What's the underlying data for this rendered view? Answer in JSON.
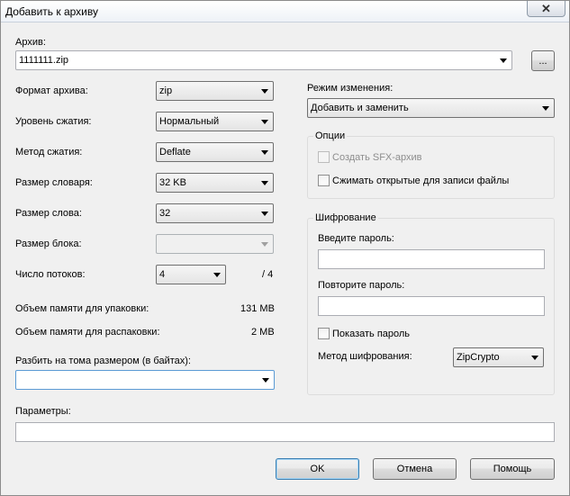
{
  "window": {
    "title": "Добавить к архиву"
  },
  "archive": {
    "label": "Архив:",
    "value": "1111111.zip",
    "browse_label": "..."
  },
  "left": {
    "format": {
      "label": "Формат архива:",
      "value": "zip"
    },
    "level": {
      "label": "Уровень сжатия:",
      "value": "Нормальный"
    },
    "method": {
      "label": "Метод сжатия:",
      "value": "Deflate"
    },
    "dict": {
      "label": "Размер словаря:",
      "value": "32 KB"
    },
    "word": {
      "label": "Размер слова:",
      "value": "32"
    },
    "block": {
      "label": "Размер блока:",
      "value": ""
    },
    "threads": {
      "label": "Число потоков:",
      "value": "4",
      "max": "/ 4"
    },
    "mem_pack": {
      "label": "Объем памяти для упаковки:",
      "value": "131 MB"
    },
    "mem_unpack": {
      "label": "Объем памяти для распаковки:",
      "value": "2 MB"
    },
    "split": {
      "label": "Разбить на тома размером (в байтах):",
      "value": ""
    }
  },
  "right": {
    "update_mode": {
      "label": "Режим изменения:",
      "value": "Добавить и заменить"
    },
    "options": {
      "title": "Опции",
      "sfx_label": "Создать SFX-архив",
      "shared_label": "Сжимать открытые для записи файлы"
    },
    "encryption": {
      "title": "Шифрование",
      "password_label": "Введите пароль:",
      "repeat_label": "Повторите пароль:",
      "show_label": "Показать пароль",
      "method_label": "Метод шифрования:",
      "method_value": "ZipCrypto"
    }
  },
  "params": {
    "label": "Параметры:",
    "value": ""
  },
  "buttons": {
    "ok": "OK",
    "cancel": "Отмена",
    "help": "Помощь"
  }
}
